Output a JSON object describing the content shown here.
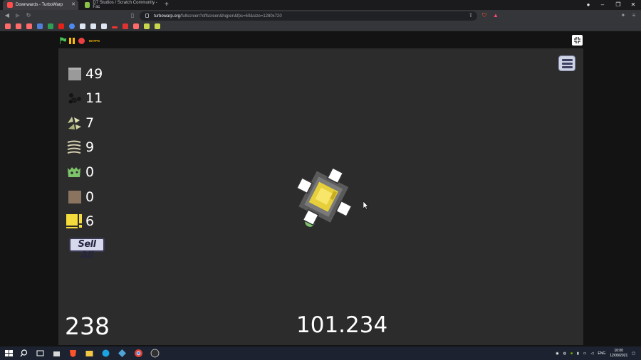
{
  "browser": {
    "tabs": [
      {
        "title": "Downwards - TurboWarp",
        "active": true
      },
      {
        "title": "D7 Studios / Scratch Community - Fac",
        "active": false
      }
    ],
    "new_tab": "+",
    "window_buttons": [
      "–",
      "❐",
      "✕"
    ],
    "url_host": "turbowarp.org",
    "url_path": "/fullscreen?offscreen&hqpen&fps=60&size=1280x720",
    "accent": "#ffbf00"
  },
  "player": {
    "fps_label": "60 FPS"
  },
  "game": {
    "resources": [
      {
        "name": "stone",
        "value": "49"
      },
      {
        "name": "coal",
        "value": "11"
      },
      {
        "name": "crystal",
        "value": "7"
      },
      {
        "name": "fiber",
        "value": "9"
      },
      {
        "name": "slime",
        "value": "0"
      },
      {
        "name": "dirt",
        "value": "0"
      },
      {
        "name": "alert-block",
        "value": "6"
      }
    ],
    "sell_all_label": "Sell All",
    "bottom_left_value": "238",
    "bottom_center_value": "101.234"
  },
  "taskbar": {
    "language": "ENG",
    "time": "10:00",
    "date": "12/09/2021"
  }
}
